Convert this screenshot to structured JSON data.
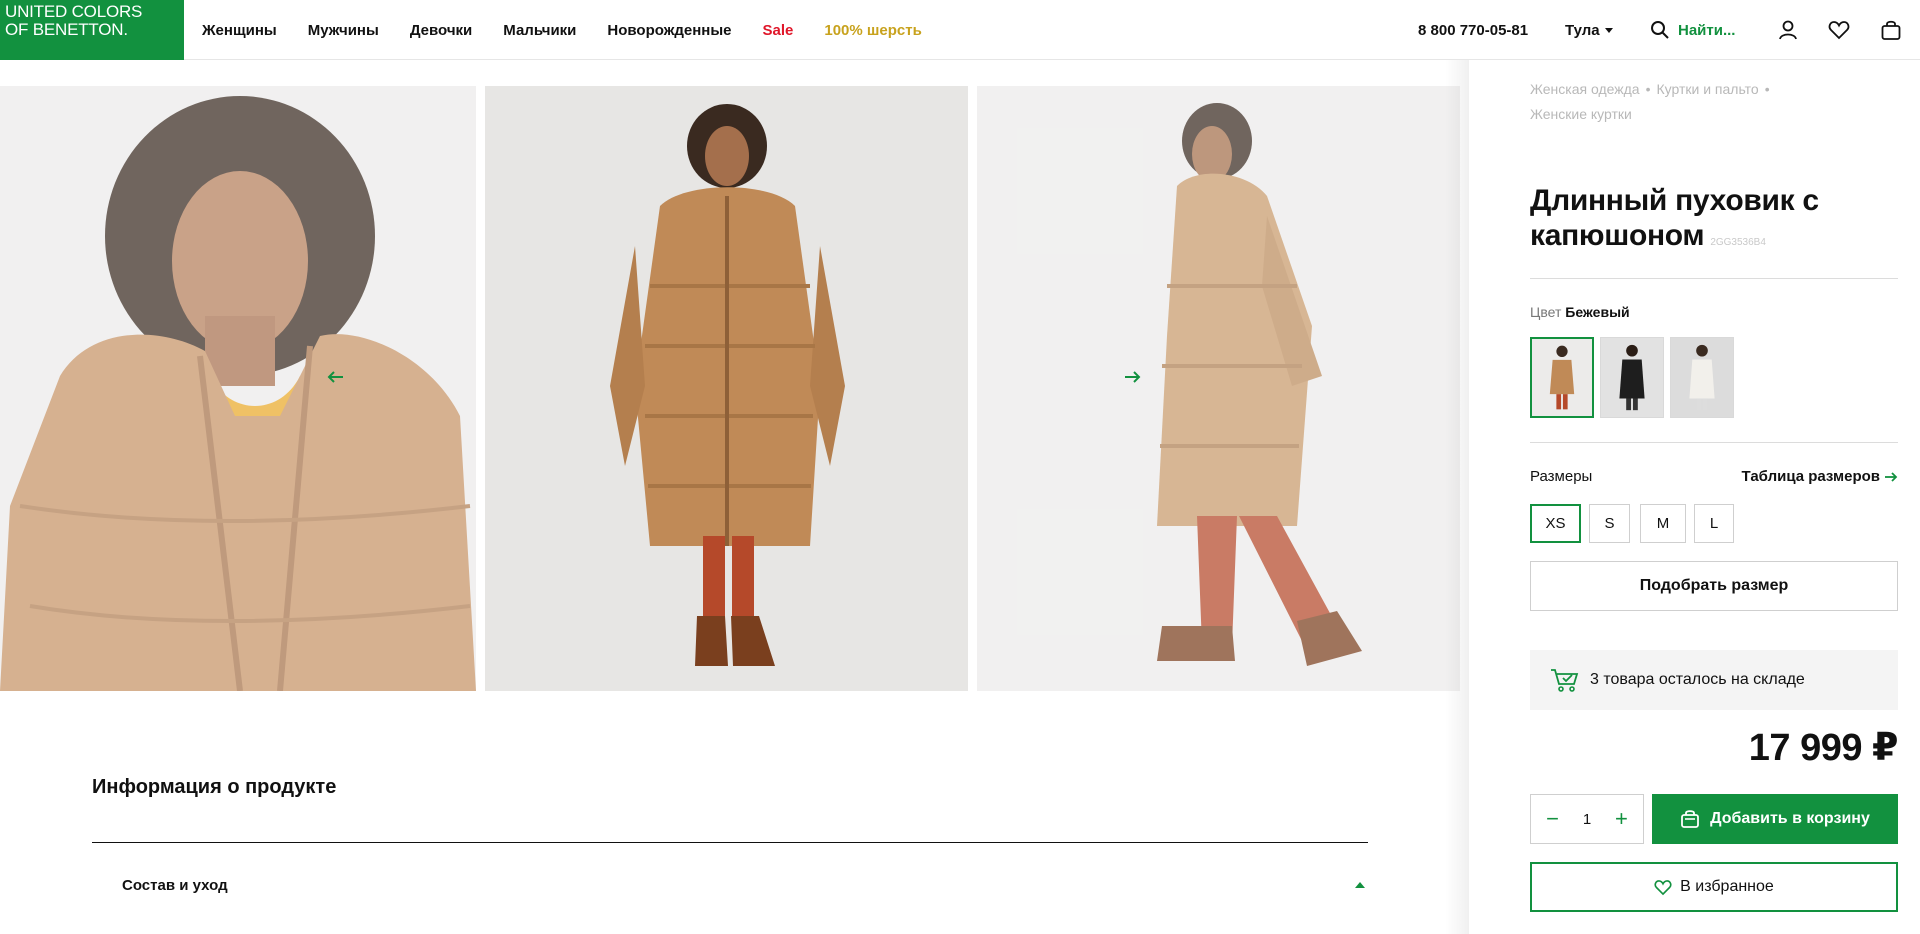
{
  "header": {
    "logo_line1": "UNITED COLORS",
    "logo_line2": "OF BENETTON.",
    "nav": [
      "Женщины",
      "Мужчины",
      "Девочки",
      "Мальчики",
      "Новорожденные",
      "Sale",
      "100% шерсть"
    ],
    "phone": "8 800 770-05-81",
    "city": "Тула",
    "search_placeholder": "Найти..."
  },
  "breadcrumbs": [
    "Женская одежда",
    "Куртки и пальто",
    "Женские куртки"
  ],
  "product": {
    "title_line1": "Длинный пуховик с",
    "title_line2": "капюшоном",
    "sku": "2GG3536B4",
    "color_label": "Цвет",
    "color_value": "Бежевый",
    "sizes_label": "Размеры",
    "size_table_link": "Таблица размеров",
    "sizes": [
      "XS",
      "S",
      "M",
      "L"
    ],
    "selected_size": "XS",
    "fit_button": "Подобрать размер",
    "stock_text": "3 товара осталось на складе",
    "price": "17 999 ₽",
    "quantity": "1",
    "add_to_cart": "Добавить в корзину",
    "favorite": "В избранное"
  },
  "info": {
    "title": "Информация о продукте",
    "section": "Состав и уход"
  },
  "colors": {
    "brand_green": "#12913f",
    "sale_red": "#e0172a",
    "wool_gold": "#c8a21d",
    "coat_beige": "#c89a6b"
  },
  "icons": {
    "search": "search-icon",
    "account": "user-icon",
    "favorites": "heart-icon",
    "cart": "bag-icon",
    "stock": "cart-check-icon"
  }
}
